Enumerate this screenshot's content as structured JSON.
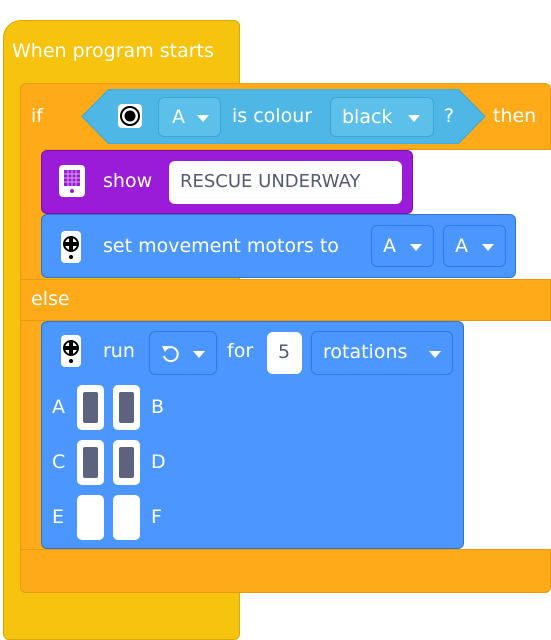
{
  "hat": {
    "label": "When program starts"
  },
  "if_block": {
    "if_label": "if",
    "then_label": "then",
    "else_label": "else",
    "condition": {
      "icon": "color-sensor-icon",
      "port": "A",
      "is_colour_label": "is colour",
      "colour": "black",
      "question": "?"
    }
  },
  "show_block": {
    "icon": "light-matrix-icon",
    "label": "show",
    "text": "RESCUE UNDERWAY"
  },
  "set_motors_block": {
    "icon": "motor-icon",
    "label": "set movement motors to",
    "port1": "A",
    "port2": "A"
  },
  "run_block": {
    "icon": "motor-icon",
    "label": "run",
    "direction_icon": "rotate-counterclockwise-icon",
    "for_label": "for",
    "amount": "5",
    "unit": "rotations",
    "ports": [
      {
        "label": "A",
        "selected": true
      },
      {
        "label": "B",
        "selected": true
      },
      {
        "label": "C",
        "selected": true
      },
      {
        "label": "D",
        "selected": true
      },
      {
        "label": "E",
        "selected": false
      },
      {
        "label": "F",
        "selected": false
      }
    ]
  },
  "colors": {
    "events": "#f6c30e",
    "control": "#ffab19",
    "motors": "#4c97ff",
    "display": "#9a1bd8",
    "sensors": "#4fb7e6"
  }
}
